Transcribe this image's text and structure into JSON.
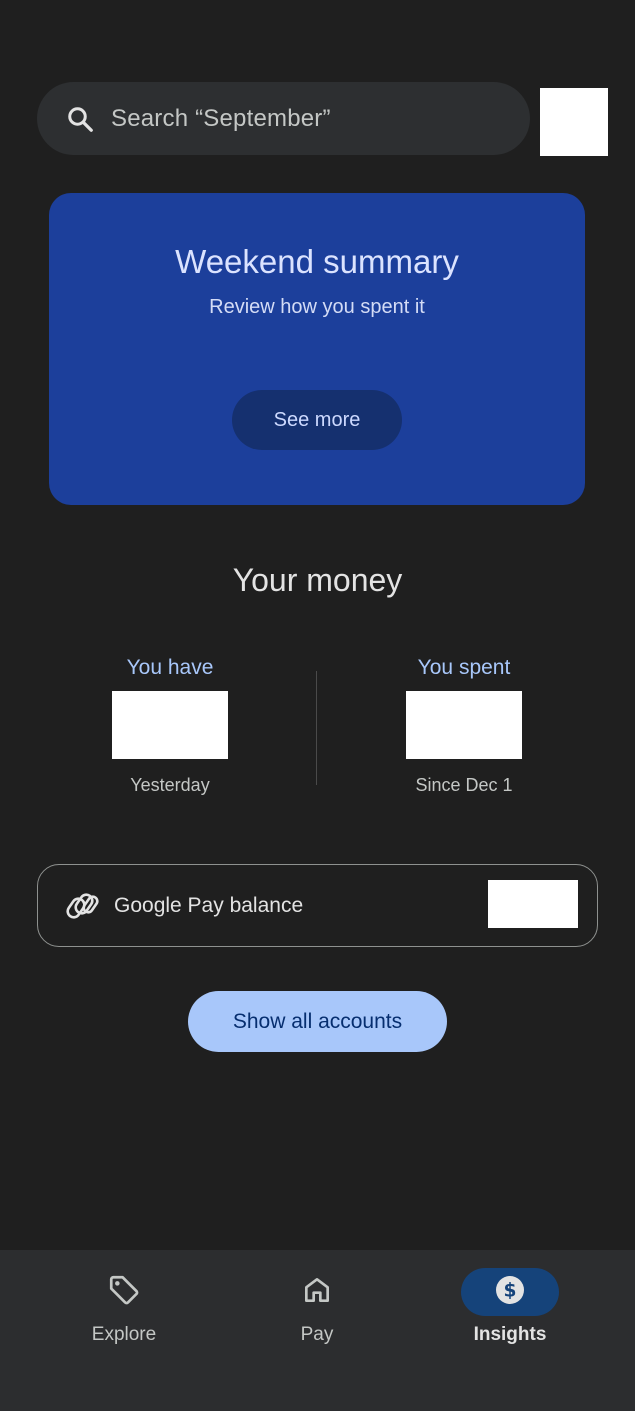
{
  "search": {
    "placeholder_text": "Search “September”",
    "icon": "search-icon"
  },
  "summary_card": {
    "title": "Weekend summary",
    "subtitle": "Review how you spent it",
    "button_label": "See more",
    "background_color": "#1c3f9b"
  },
  "money": {
    "title": "Your money",
    "have": {
      "label": "You have",
      "caption": "Yesterday"
    },
    "spent": {
      "label": "You spent",
      "caption": "Since Dec 1"
    }
  },
  "balance": {
    "label": "Google Pay balance",
    "icon": "google-pay-icon"
  },
  "show_all_label": "Show all accounts",
  "nav": {
    "items": [
      {
        "label": "Explore",
        "icon": "tag-icon",
        "selected": false
      },
      {
        "label": "Pay",
        "icon": "home-icon",
        "selected": false
      },
      {
        "label": "Insights",
        "icon": "dollar-icon",
        "selected": true
      }
    ]
  },
  "colors": {
    "background": "#1f1f1f",
    "accent": "#a8c7fa",
    "nav_active_pill": "#15437a"
  }
}
